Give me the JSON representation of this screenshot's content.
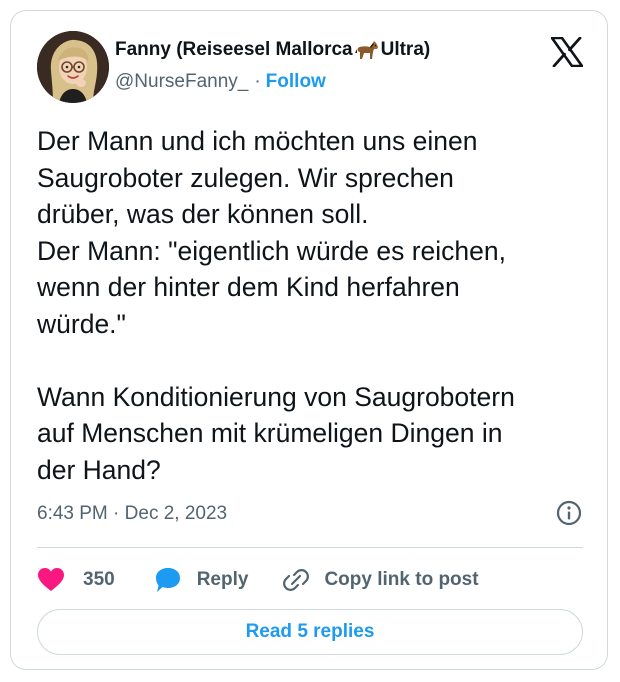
{
  "author": {
    "name_part1": "Fanny (Reiseesel Mallorca ",
    "name_emoji": "horse-emoji",
    "name_part2": "Ultra)",
    "handle": "@NurseFanny_",
    "separator": "·",
    "follow_label": "Follow",
    "avatar_icon": "avatar-illustration"
  },
  "platform_icon": "x-logo-icon",
  "tweet": {
    "text": "Der Mann und ich möchten uns einen\nSaugroboter zulegen. Wir sprechen\ndrüber, was der können soll.\nDer Mann: \"eigentlich würde es reichen,\nwenn der hinter dem Kind herfahren\nwürde.\"\n\nWann Konditionierung von Saugrobotern\nauf Menschen mit krümeligen Dingen in\nder Hand?"
  },
  "meta": {
    "time": "6:43 PM",
    "separator": " · ",
    "date": "Dec 2, 2023",
    "info_icon": "info-icon"
  },
  "actions": {
    "likes": "350",
    "like_icon": "heart-icon",
    "like_color": "#f91880",
    "reply_label": "Reply",
    "reply_icon": "reply-bubble-icon",
    "reply_color": "#1d9bf0",
    "copy_label": "Copy link to post",
    "copy_icon": "link-icon"
  },
  "read_replies_label": "Read 5 replies",
  "colors": {
    "accent": "#1d9bf0",
    "text": "#0f1419",
    "secondary": "#536471",
    "border": "#cfd9de"
  }
}
